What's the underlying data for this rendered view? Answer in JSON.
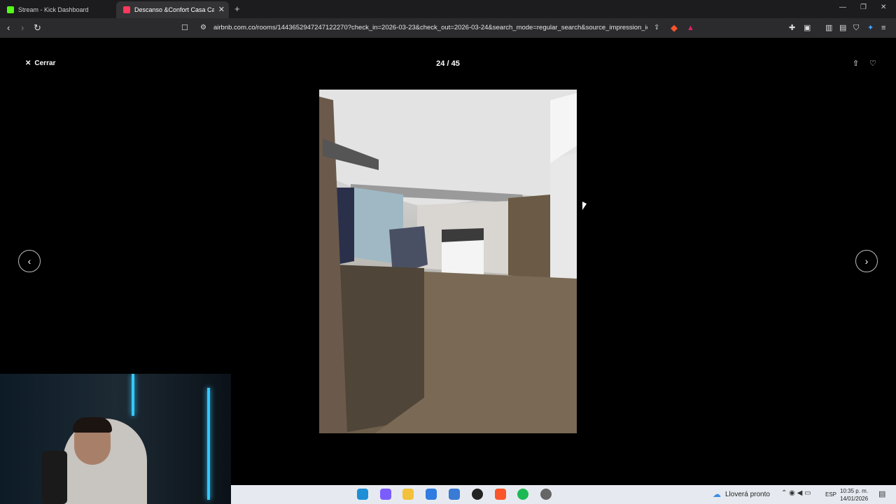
{
  "browser": {
    "tabs": [
      {
        "label": "Stream - Kick Dashboard",
        "color": "#53fc18"
      },
      {
        "label": "Descanso &Confort Casa Campe",
        "color": "#ff385c"
      }
    ],
    "url": "airbnb.com.co/rooms/1443652947247122270?check_in=2026-03-23&check_out=2026-03-24&search_mode=regular_search&source_impression_id=..."
  },
  "viewer": {
    "close_label": "Cerrar",
    "counter": "24 / 45"
  },
  "taskbar": {
    "weather": "Lloverá pronto",
    "language": "ESP",
    "time": "10:35 p. m.",
    "date": "14/01/2026"
  }
}
